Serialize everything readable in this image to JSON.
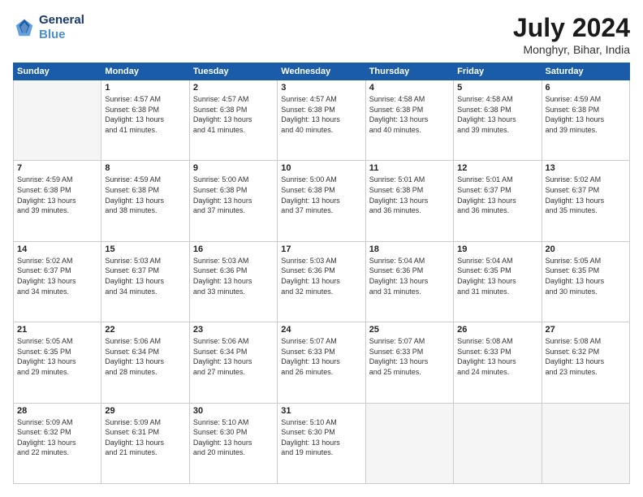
{
  "header": {
    "logo_line1": "General",
    "logo_line2": "Blue",
    "month_year": "July 2024",
    "location": "Monghyr, Bihar, India"
  },
  "days_of_week": [
    "Sunday",
    "Monday",
    "Tuesday",
    "Wednesday",
    "Thursday",
    "Friday",
    "Saturday"
  ],
  "weeks": [
    [
      {
        "day": "",
        "info": ""
      },
      {
        "day": "1",
        "info": "Sunrise: 4:57 AM\nSunset: 6:38 PM\nDaylight: 13 hours\nand 41 minutes."
      },
      {
        "day": "2",
        "info": "Sunrise: 4:57 AM\nSunset: 6:38 PM\nDaylight: 13 hours\nand 41 minutes."
      },
      {
        "day": "3",
        "info": "Sunrise: 4:57 AM\nSunset: 6:38 PM\nDaylight: 13 hours\nand 40 minutes."
      },
      {
        "day": "4",
        "info": "Sunrise: 4:58 AM\nSunset: 6:38 PM\nDaylight: 13 hours\nand 40 minutes."
      },
      {
        "day": "5",
        "info": "Sunrise: 4:58 AM\nSunset: 6:38 PM\nDaylight: 13 hours\nand 39 minutes."
      },
      {
        "day": "6",
        "info": "Sunrise: 4:59 AM\nSunset: 6:38 PM\nDaylight: 13 hours\nand 39 minutes."
      }
    ],
    [
      {
        "day": "7",
        "info": "Sunrise: 4:59 AM\nSunset: 6:38 PM\nDaylight: 13 hours\nand 39 minutes."
      },
      {
        "day": "8",
        "info": "Sunrise: 4:59 AM\nSunset: 6:38 PM\nDaylight: 13 hours\nand 38 minutes."
      },
      {
        "day": "9",
        "info": "Sunrise: 5:00 AM\nSunset: 6:38 PM\nDaylight: 13 hours\nand 37 minutes."
      },
      {
        "day": "10",
        "info": "Sunrise: 5:00 AM\nSunset: 6:38 PM\nDaylight: 13 hours\nand 37 minutes."
      },
      {
        "day": "11",
        "info": "Sunrise: 5:01 AM\nSunset: 6:38 PM\nDaylight: 13 hours\nand 36 minutes."
      },
      {
        "day": "12",
        "info": "Sunrise: 5:01 AM\nSunset: 6:37 PM\nDaylight: 13 hours\nand 36 minutes."
      },
      {
        "day": "13",
        "info": "Sunrise: 5:02 AM\nSunset: 6:37 PM\nDaylight: 13 hours\nand 35 minutes."
      }
    ],
    [
      {
        "day": "14",
        "info": "Sunrise: 5:02 AM\nSunset: 6:37 PM\nDaylight: 13 hours\nand 34 minutes."
      },
      {
        "day": "15",
        "info": "Sunrise: 5:03 AM\nSunset: 6:37 PM\nDaylight: 13 hours\nand 34 minutes."
      },
      {
        "day": "16",
        "info": "Sunrise: 5:03 AM\nSunset: 6:36 PM\nDaylight: 13 hours\nand 33 minutes."
      },
      {
        "day": "17",
        "info": "Sunrise: 5:03 AM\nSunset: 6:36 PM\nDaylight: 13 hours\nand 32 minutes."
      },
      {
        "day": "18",
        "info": "Sunrise: 5:04 AM\nSunset: 6:36 PM\nDaylight: 13 hours\nand 31 minutes."
      },
      {
        "day": "19",
        "info": "Sunrise: 5:04 AM\nSunset: 6:35 PM\nDaylight: 13 hours\nand 31 minutes."
      },
      {
        "day": "20",
        "info": "Sunrise: 5:05 AM\nSunset: 6:35 PM\nDaylight: 13 hours\nand 30 minutes."
      }
    ],
    [
      {
        "day": "21",
        "info": "Sunrise: 5:05 AM\nSunset: 6:35 PM\nDaylight: 13 hours\nand 29 minutes."
      },
      {
        "day": "22",
        "info": "Sunrise: 5:06 AM\nSunset: 6:34 PM\nDaylight: 13 hours\nand 28 minutes."
      },
      {
        "day": "23",
        "info": "Sunrise: 5:06 AM\nSunset: 6:34 PM\nDaylight: 13 hours\nand 27 minutes."
      },
      {
        "day": "24",
        "info": "Sunrise: 5:07 AM\nSunset: 6:33 PM\nDaylight: 13 hours\nand 26 minutes."
      },
      {
        "day": "25",
        "info": "Sunrise: 5:07 AM\nSunset: 6:33 PM\nDaylight: 13 hours\nand 25 minutes."
      },
      {
        "day": "26",
        "info": "Sunrise: 5:08 AM\nSunset: 6:33 PM\nDaylight: 13 hours\nand 24 minutes."
      },
      {
        "day": "27",
        "info": "Sunrise: 5:08 AM\nSunset: 6:32 PM\nDaylight: 13 hours\nand 23 minutes."
      }
    ],
    [
      {
        "day": "28",
        "info": "Sunrise: 5:09 AM\nSunset: 6:32 PM\nDaylight: 13 hours\nand 22 minutes."
      },
      {
        "day": "29",
        "info": "Sunrise: 5:09 AM\nSunset: 6:31 PM\nDaylight: 13 hours\nand 21 minutes."
      },
      {
        "day": "30",
        "info": "Sunrise: 5:10 AM\nSunset: 6:30 PM\nDaylight: 13 hours\nand 20 minutes."
      },
      {
        "day": "31",
        "info": "Sunrise: 5:10 AM\nSunset: 6:30 PM\nDaylight: 13 hours\nand 19 minutes."
      },
      {
        "day": "",
        "info": ""
      },
      {
        "day": "",
        "info": ""
      },
      {
        "day": "",
        "info": ""
      }
    ]
  ]
}
